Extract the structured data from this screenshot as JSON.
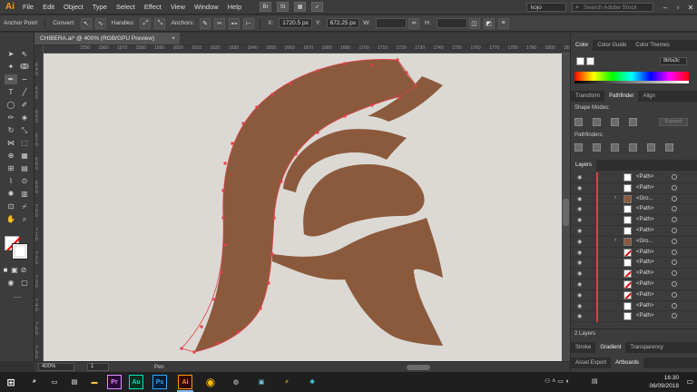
{
  "app": {
    "logo": "Ai",
    "menu": [
      "File",
      "Edit",
      "Object",
      "Type",
      "Select",
      "Effect",
      "View",
      "Window",
      "Help"
    ],
    "bridge_buttons": [
      "Br",
      "St"
    ],
    "user": "kojo",
    "search_placeholder": "Search Adobe Stock"
  },
  "control_bar": {
    "tool_label": "Anchor Point",
    "convert_label": "Convert:",
    "handles_label": "Handles:",
    "anchors_label": "Anchors:",
    "x_label": "X:",
    "x_value": "1720.5 px",
    "y_label": "Y:",
    "y_value": "672.25 px",
    "w_label": "W:",
    "h_label": "H:"
  },
  "document": {
    "tab_title": "CHIBERA.ai* @ 400% (RGB/GPU Preview)",
    "close_glyph": "×"
  },
  "rulers": {
    "top": [
      "1550",
      "1560",
      "1570",
      "1580",
      "1590",
      "1600",
      "1610",
      "1620",
      "1630",
      "1640",
      "1650",
      "1660",
      "1670",
      "1680",
      "1690",
      "1700",
      "1710",
      "1720",
      "1730",
      "1740",
      "1750",
      "1760",
      "1770",
      "1780",
      "1790",
      "1800",
      "1810"
    ],
    "left": [
      "6 4 0",
      "6 5 0",
      "6 6 0",
      "6 7 0",
      "6 8 0",
      "6 9 0",
      "7 0 0",
      "7 1 0",
      "7 2 0",
      "7 3 0",
      "7 4 0",
      "7 5 0",
      "7 6 0"
    ]
  },
  "artwork": {
    "fill_color": "#8b5a3c",
    "path_color": "#e0404a",
    "canvas_color": "#dcd9d5"
  },
  "status": {
    "zoom": "400%",
    "artboard": "1",
    "tool_name": "Pen"
  },
  "panels": {
    "color_tabs": [
      "Color",
      "Color Guide",
      "Color Themes"
    ],
    "hex_value": "8b5a3c",
    "path_tabs": [
      "Transform",
      "Pathfinder",
      "Align"
    ],
    "shape_modes_label": "Shape Modes:",
    "pathfinders_label": "Pathfinders:",
    "expand_label": "Expand",
    "layers_tab": "Layers",
    "layers": [
      {
        "name": "<Path>",
        "thumb": "white",
        "arrow": ""
      },
      {
        "name": "<Path>",
        "thumb": "white",
        "arrow": ""
      },
      {
        "name": "<Gro...",
        "thumb": "brown",
        "arrow": "›"
      },
      {
        "name": "<Path>",
        "thumb": "white",
        "arrow": ""
      },
      {
        "name": "<Path>",
        "thumb": "white",
        "arrow": ""
      },
      {
        "name": "<Path>",
        "thumb": "white",
        "arrow": ""
      },
      {
        "name": "<Gro...",
        "thumb": "brown",
        "arrow": "›"
      },
      {
        "name": "<Path>",
        "thumb": "strike",
        "arrow": ""
      },
      {
        "name": "<Path>",
        "thumb": "white",
        "arrow": ""
      },
      {
        "name": "<Path>",
        "thumb": "strike",
        "arrow": ""
      },
      {
        "name": "<Path>",
        "thumb": "strike",
        "arrow": ""
      },
      {
        "name": "<Path>",
        "thumb": "strike",
        "arrow": ""
      },
      {
        "name": "<Path>",
        "thumb": "white",
        "arrow": ""
      },
      {
        "name": "<Path>",
        "thumb": "white",
        "arrow": ""
      }
    ],
    "layers_count": "2 Layers",
    "bottom_tabs_1": [
      "Stroke",
      "Gradient",
      "Transparency"
    ],
    "bottom_tabs_2": [
      "Asset Export",
      "Artboards"
    ]
  },
  "taskbar": {
    "apps": [
      "Pr",
      "Au",
      "Ps",
      "Ai"
    ],
    "time": "16:30",
    "date": "06/09/2018"
  }
}
